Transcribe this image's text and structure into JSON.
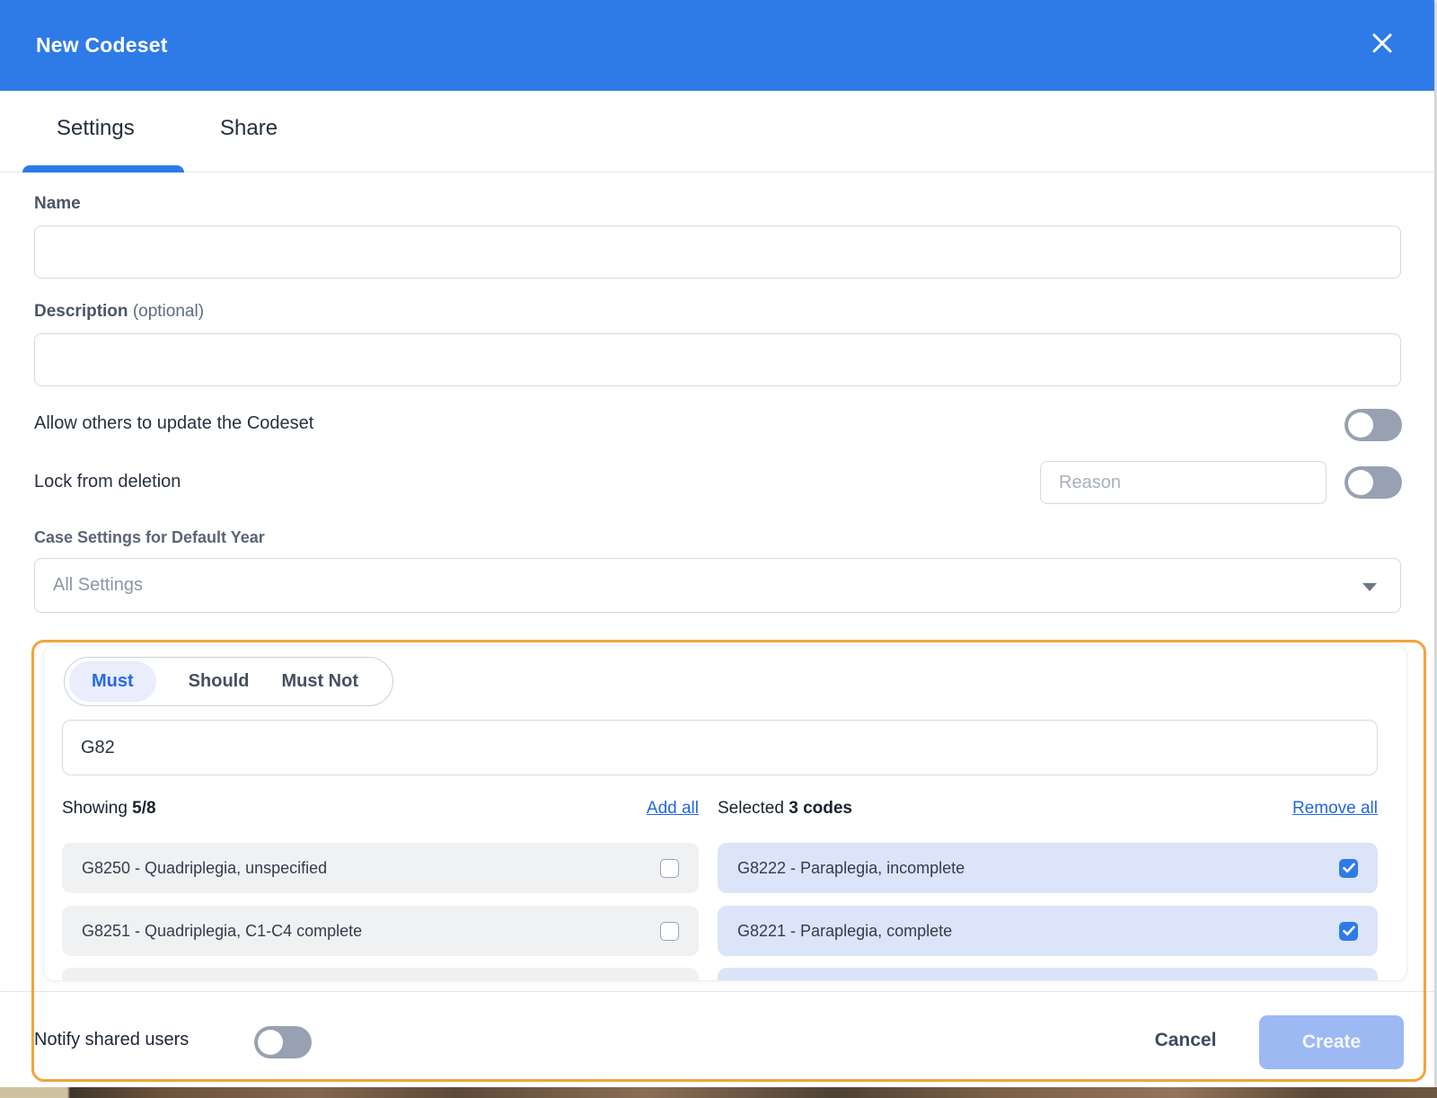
{
  "colors": {
    "accent_blue": "#2e7be8",
    "link_blue": "#2465e6",
    "highlight_orange": "#f1a43c",
    "available_row_bg": "#f0f1f3",
    "selected_row_bg": "#dbe4f8",
    "disabled_create_bg": "#9db9f3",
    "toggle_off_track": "#97a1b1"
  },
  "modal": {
    "title": "New Codeset"
  },
  "tabs": {
    "settings": "Settings",
    "share": "Share"
  },
  "form": {
    "name_label": "Name",
    "name_value": "",
    "description_label": "Description",
    "description_optional": "(optional)",
    "description_value": "",
    "allow_update_label": "Allow others to update the Codeset",
    "lock_deletion_label": "Lock from deletion",
    "reason_placeholder": "Reason",
    "case_settings_label": "Case Settings for Default Year",
    "case_settings_value": "All Settings"
  },
  "codes": {
    "mode_must": "Must",
    "mode_should": "Should",
    "mode_must_not": "Must Not",
    "search_value": "G82",
    "showing_prefix": "Showing",
    "showing_count": "5/8",
    "add_all": "Add all",
    "selected_prefix": "Selected",
    "selected_count": "3 codes",
    "remove_all": "Remove all",
    "available_items": [
      {
        "label": "G8250 - Quadriplegia, unspecified"
      },
      {
        "label": "G8251 - Quadriplegia, C1-C4 complete"
      }
    ],
    "selected_items": [
      {
        "label": "G8222 - Paraplegia, incomplete"
      },
      {
        "label": "G8221 - Paraplegia, complete"
      }
    ]
  },
  "footer": {
    "notify_label": "Notify shared users",
    "cancel": "Cancel",
    "create": "Create"
  }
}
